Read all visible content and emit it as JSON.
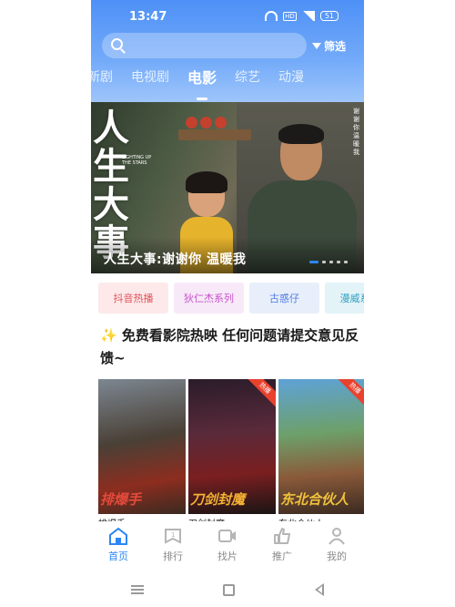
{
  "status_bar": {
    "time": "13:47",
    "network_badge": "HD",
    "battery": "51"
  },
  "search": {
    "placeholder": ""
  },
  "filter": {
    "label": "筛选"
  },
  "tabs": [
    {
      "label": "新剧"
    },
    {
      "label": "电视剧"
    },
    {
      "label": "电影",
      "active": true
    },
    {
      "label": "综艺"
    },
    {
      "label": "动漫"
    }
  ],
  "banner": {
    "caption": "人生大事:谢谢你 温暖我",
    "poster_title": "人生大事",
    "poster_subtitle": "LIGHTING UP THE STARS",
    "poster_side_text": "谢谢你温暖我",
    "dots": 5,
    "active_dot": 0,
    "active_dot_color": "#2c86f5"
  },
  "chips": [
    {
      "label": "抖音热播",
      "color": "#e0525b",
      "bg": "#fde9ea"
    },
    {
      "label": "狄仁杰系列",
      "color": "#c653c9",
      "bg": "#f8e9f8"
    },
    {
      "label": "古惑仔",
      "color": "#4f7be0",
      "bg": "#e8effb"
    },
    {
      "label": "漫威系列",
      "color": "#2f9fc1",
      "bg": "#e3f3f8"
    }
  ],
  "notice": {
    "icon": "✨",
    "text": "免费看影院热映 任何问题请提交意见反馈~"
  },
  "movies": [
    {
      "poster_text": "排爆手",
      "caption": "排爆手",
      "name_color": "#e34a3b",
      "ribbon": ""
    },
    {
      "poster_text": "刀剑封魔",
      "caption": "刀剑封魔",
      "name_color": "#f3b233",
      "ribbon": "热播"
    },
    {
      "poster_text": "东北合伙人",
      "caption": "东北合伙人",
      "name_color": "#f2c33b",
      "ribbon": "热播"
    }
  ],
  "bottom_nav": [
    {
      "label": "首页",
      "icon": "home-icon",
      "active": true
    },
    {
      "label": "排行",
      "icon": "ranking-icon"
    },
    {
      "label": "找片",
      "icon": "video-icon"
    },
    {
      "label": "推广",
      "icon": "thumbs-up-icon"
    },
    {
      "label": "我的",
      "icon": "user-icon"
    }
  ],
  "accent_color": "#2c86f5"
}
